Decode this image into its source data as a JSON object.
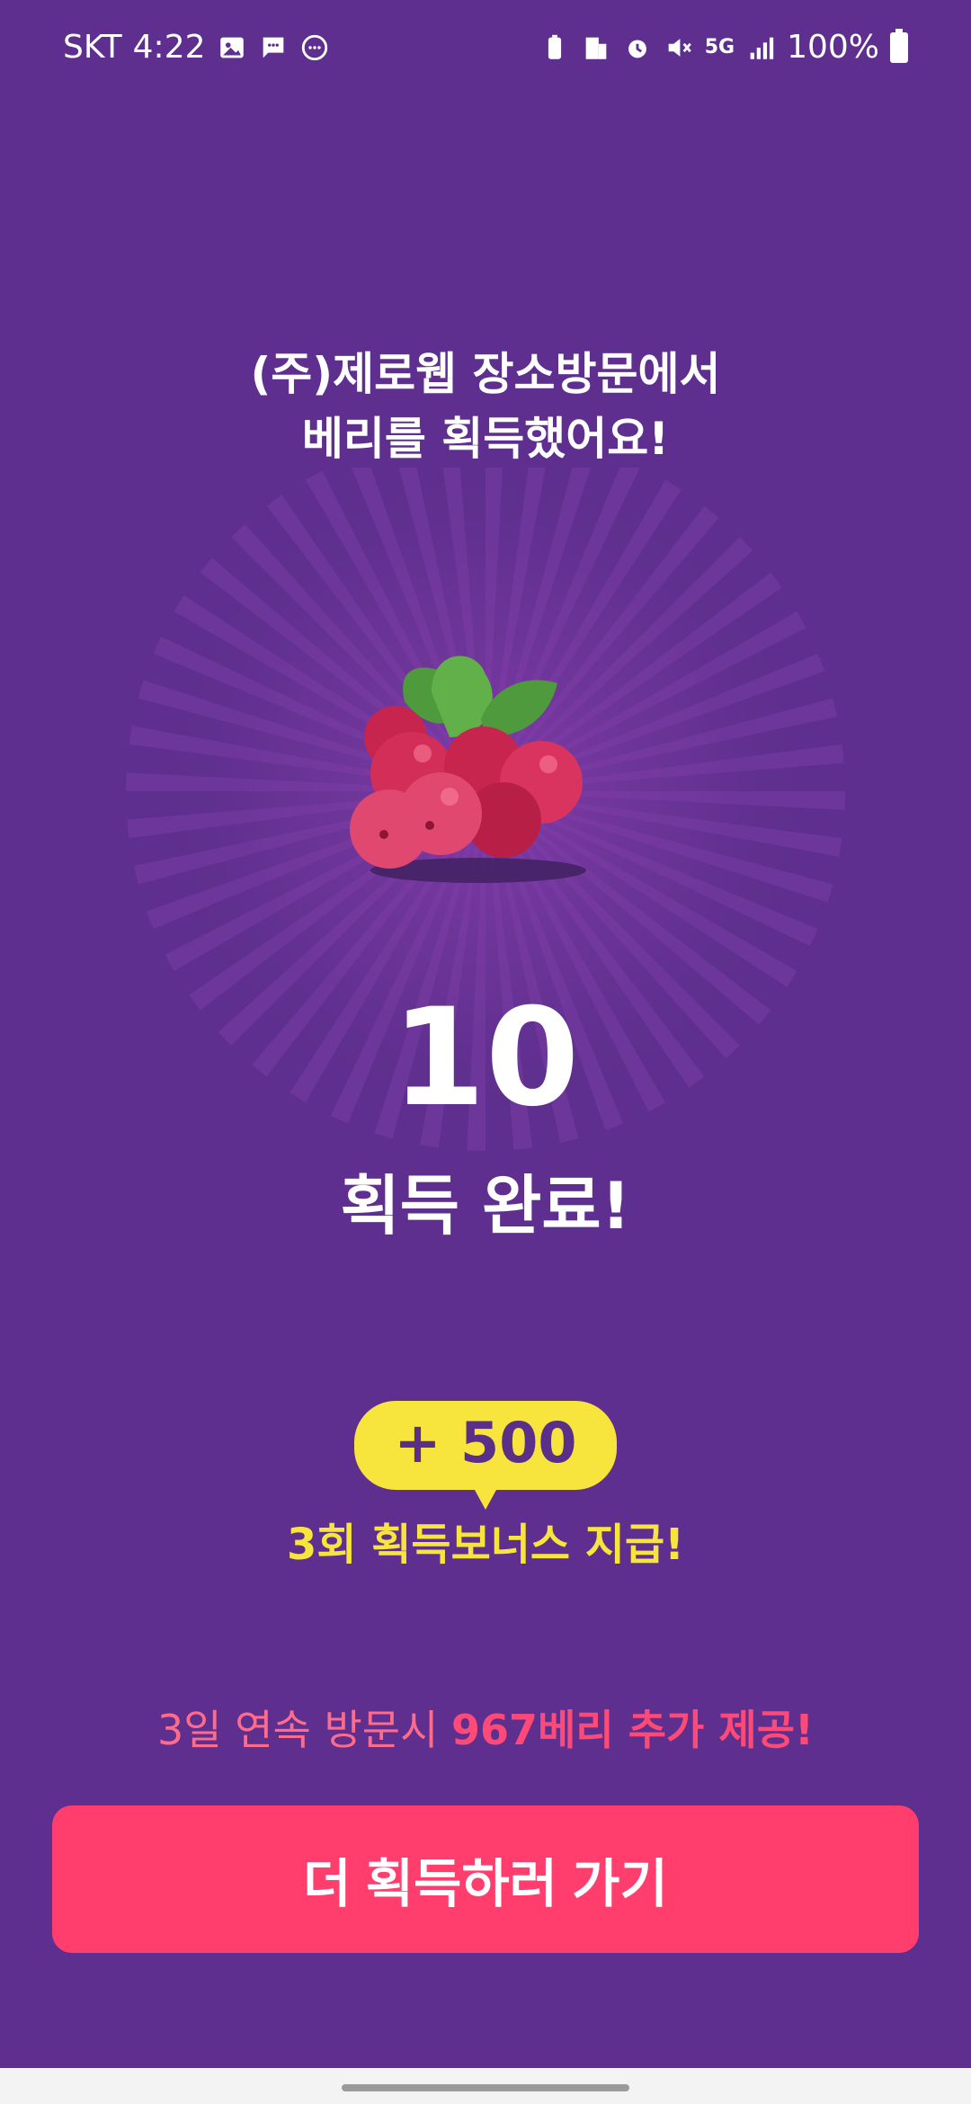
{
  "status_bar": {
    "carrier": "SKT",
    "time": "4:22",
    "network": "5G",
    "battery": "100%",
    "icons": [
      "gallery-icon",
      "message-icon",
      "chat-icon",
      "battery-saver-icon",
      "building-icon",
      "alarm-icon",
      "mute-icon",
      "5g-icon",
      "signal-icon",
      "battery-icon"
    ]
  },
  "headline": {
    "line1": "(주)제로웹 장소방문에서",
    "line2": "베리를 획득했어요!"
  },
  "reward": {
    "count": "10",
    "label": "획득 완료!"
  },
  "bonus": {
    "amount": "+ 500",
    "text": "3회 획득보너스 지급!"
  },
  "streak": {
    "prefix": "3일 연속 방문시 ",
    "highlight": "967베리 추가 제공!"
  },
  "cta": {
    "label": "더 획득하러 가기"
  },
  "colors": {
    "background": "#5e2f8e",
    "accent_yellow": "#f7e43c",
    "cta_pink": "#ff3e6e"
  }
}
